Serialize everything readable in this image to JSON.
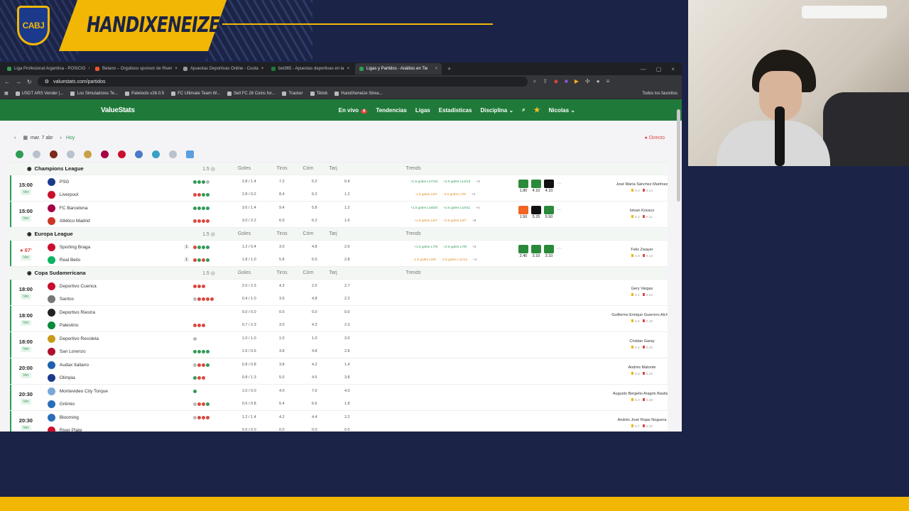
{
  "overlay": {
    "crest_text": "CABJ",
    "channel_name": "HANDIXENEIZE"
  },
  "browser": {
    "tabs": [
      {
        "title": "Liga Profesional Argentina - POSICIO",
        "color": "#2f9b56"
      },
      {
        "title": "Betano – Orgulloso sponsor de River",
        "color": "#e8572a"
      },
      {
        "title": "Apuestas Deportivas Online - Cuota",
        "color": "#999999"
      },
      {
        "title": "bet365 - Apuestas deportivas en la",
        "color": "#1f7a3a"
      },
      {
        "title": "Ligas y Partidos - Análisis en Tie",
        "color": "#2f9b56",
        "active": true
      }
    ],
    "url": "valuestats.com/partidos",
    "bookmarks": [
      "USDT ARS Vender |...",
      "Los Simuladores Te...",
      "Paletools v26.0.5",
      "FC Ultimate Team W...",
      "Sell FC 26 Coins for...",
      "Tracker",
      "Tiktok",
      "HandiXeneize Strea..."
    ],
    "bookmarks_right": "Todos los favoritos"
  },
  "site": {
    "logo": "ValueStats",
    "nav": {
      "live": "En vivo",
      "live_count": "6",
      "trends": "Tendencias",
      "leagues": "Ligas",
      "stats": "Estadísticas",
      "discipline": "Disciplina ⌄",
      "user": "Nicolas ⌄"
    },
    "date": "mar. 7 abr",
    "today": "Hoy",
    "live_label": "● Directo",
    "columns": {
      "line": "1.5 ◎",
      "goals": "Goles",
      "shots": "Tiros",
      "corners": "Córn",
      "cards": "Tarj",
      "trends": "Trends"
    },
    "ver_label": "Ver",
    "leagues": [
      {
        "name": "Champions League",
        "matches": [
          {
            "time": "15:00",
            "live": false,
            "home": {
              "name": "PSG",
              "color": "#1b3a8c",
              "form": [
                "g",
                "g",
                "g",
                "x"
              ],
              "goals": "2.8 / 1.4",
              "shots": "7.2",
              "corners": "5.2",
              "cards": "0.4"
            },
            "away": {
              "name": "Liverpool",
              "color": "#c8102e",
              "form": [
                "r",
                "r",
                "g",
                "g"
              ],
              "goals": "2.8 / 0.2",
              "shots": "8.4",
              "corners": "6.2",
              "cards": "1.2"
            },
            "trends_home": [
              "+1.5 goles L17/18",
              "+2.5 goles L12/13",
              "+6"
            ],
            "trends_away": [
              "-1.5 goles L6/7",
              "-2.5 goles L7/8",
              "+2"
            ],
            "odds": [
              {
                "v": "1.80",
                "c": "#2a8a3a"
              },
              {
                "v": "4.10",
                "c": "#2a8a3a"
              },
              {
                "v": "4.10",
                "c": "#111111"
              }
            ],
            "ref": {
              "name": "José María Sánchez Martínez",
              "y": "5.0",
              "r": "0.14"
            }
          },
          {
            "time": "15:00",
            "live": false,
            "home": {
              "name": "FC Barcelona",
              "color": "#a50044",
              "form": [
                "g",
                "g",
                "g",
                "g"
              ],
              "goals": "3.6 / 1.4",
              "shots": "9.4",
              "corners": "5.8",
              "cards": "1.2"
            },
            "away": {
              "name": "Atlético Madrid",
              "color": "#cb3524",
              "form": [
                "r",
                "r",
                "r",
                "r"
              ],
              "goals": "3.0 / 2.2",
              "shots": "6.0",
              "corners": "6.2",
              "cards": "1.6"
            },
            "trends_home": [
              "+1.5 goles L19/20",
              "+2.5 goles L10/11",
              "+4"
            ],
            "trends_away": [
              "+1.5 goles L6/7",
              "+2.5 goles L6/7",
              "+8"
            ],
            "odds": [
              {
                "v": "1.50",
                "c": "#f26522"
              },
              {
                "v": "5.25",
                "c": "#111111"
              },
              {
                "v": "5.50",
                "c": "#2a8a3a"
              }
            ],
            "ref": {
              "name": "Istvan Kovacs",
              "y": "5.2",
              "r": "0.11"
            }
          }
        ]
      },
      {
        "name": "Europa League",
        "matches": [
          {
            "time": "● 87'",
            "live": true,
            "home": {
              "name": "Sporting Braga",
              "color": "#c8102e",
              "rc": "1",
              "form": [
                "r",
                "g",
                "g",
                "g"
              ],
              "goals": "1.2 / 0.4",
              "shots": "3.0",
              "corners": "4.8",
              "cards": "2.6"
            },
            "away": {
              "name": "Real Betis",
              "color": "#0bb363",
              "rc": "1",
              "form": [
                "r",
                "g",
                "r",
                "g"
              ],
              "goals": "1.8 / 1.0",
              "shots": "5.8",
              "corners": "5.0",
              "cards": "2.8"
            },
            "trends_home": [
              "+1.5 goles L7/8",
              "+2.5 goles L7/8",
              "+6"
            ],
            "trends_away": [
              "-1.5 goles L8/9",
              "-2.5 goles L11/12",
              "+4"
            ],
            "odds": [
              {
                "v": "2.40",
                "c": "#2a8a3a"
              },
              {
                "v": "3.10",
                "c": "#2a8a3a"
              },
              {
                "v": "3.10",
                "c": "#2a8a3a"
              }
            ],
            "ref": {
              "name": "Felix Zwayer",
              "y": "4.8",
              "r": "0.13"
            }
          }
        ]
      },
      {
        "name": "Copa Sudamericana",
        "matches": [
          {
            "time": "18:00",
            "live": false,
            "home": {
              "name": "Deportivo Cuenca",
              "color": "#c8102e",
              "form": [
                "r",
                "r",
                "r"
              ],
              "goals": "2.0 / 2.3",
              "shots": "4.3",
              "corners": "2.0",
              "cards": "2.7"
            },
            "away": {
              "name": "Santos",
              "color": "#777777",
              "form": [
                "x",
                "r",
                "r",
                "r",
                "r"
              ],
              "goals": "0.4 / 1.0",
              "shots": "3.6",
              "corners": "4.8",
              "cards": "2.2"
            },
            "ref": {
              "name": "Gery Vargas",
              "y": "6.1",
              "r": "0.22"
            }
          },
          {
            "time": "18:00",
            "live": false,
            "home": {
              "name": "Deportivo Riestra",
              "color": "#222222",
              "form": [],
              "goals": "0.0 / 0.0",
              "shots": "0.0",
              "corners": "0.0",
              "cards": "0.0"
            },
            "away": {
              "name": "Palestino",
              "color": "#0a8a3a",
              "form": [
                "r",
                "r",
                "r"
              ],
              "goals": "0.7 / 2.3",
              "shots": "3.0",
              "corners": "4.3",
              "cards": "2.3"
            },
            "ref": {
              "name": "Guillermo Enrique Guerrero Alcívar",
              "y": "4.5",
              "r": "0.19"
            }
          },
          {
            "time": "18:00",
            "live": false,
            "home": {
              "name": "Deportivo Recoleta",
              "color": "#c89b17",
              "form": [
                "x"
              ],
              "goals": "1.0 / 1.0",
              "shots": "1.0",
              "corners": "1.0",
              "cards": "3.0"
            },
            "away": {
              "name": "San Lorenzo",
              "color": "#b0102e",
              "form": [
                "g",
                "g",
                "g",
                "g"
              ],
              "goals": "1.6 / 0.6",
              "shots": "3.8",
              "corners": "4.8",
              "cards": "2.8"
            },
            "ref": {
              "name": "Cristian Garay",
              "y": "4.4",
              "r": "0.25"
            }
          },
          {
            "time": "20:00",
            "live": false,
            "home": {
              "name": "Audax Italiano",
              "color": "#1e5fb0",
              "form": [
                "x",
                "r",
                "r",
                "g"
              ],
              "goals": "0.8 / 0.8",
              "shots": "3.8",
              "corners": "4.2",
              "cards": "1.4"
            },
            "away": {
              "name": "Olimpia",
              "color": "#1b3a8c",
              "form": [
                "g",
                "r",
                "r"
              ],
              "goals": "0.8 / 1.3",
              "shots": "5.0",
              "corners": "4.5",
              "cards": "3.8"
            },
            "ref": {
              "name": "Andrés Matonte",
              "y": "5.8",
              "r": "0.22"
            }
          },
          {
            "time": "20:30",
            "live": false,
            "home": {
              "name": "Montevideo City Torque",
              "color": "#7aa7d8",
              "form": [
                "g"
              ],
              "goals": "1.0 / 0.0",
              "shots": "4.0",
              "corners": "7.0",
              "cards": "4.0"
            },
            "away": {
              "name": "Grêmio",
              "color": "#2a6ebb",
              "form": [
                "x",
                "r",
                "r",
                "g"
              ],
              "goals": "0.6 / 0.8",
              "shots": "5.4",
              "corners": "6.6",
              "cards": "1.8"
            },
            "ref": {
              "name": "Augusto Bergelio Aragón Bautista",
              "y": "5.2",
              "r": "0.28"
            }
          },
          {
            "time": "20:30",
            "live": false,
            "home": {
              "name": "Blooming",
              "color": "#2a6ebb",
              "form": [
                "x",
                "r",
                "r",
                "r"
              ],
              "goals": "1.2 / 1.4",
              "shots": "4.2",
              "corners": "4.4",
              "cards": "2.2"
            },
            "away": {
              "name": "River Plate",
              "color": "#c8102e",
              "form": [],
              "goals": "0.0 / 0.0",
              "shots": "0.0",
              "corners": "0.0",
              "cards": "0.0"
            },
            "ref": {
              "name": "Andrés José Rojas Noguera",
              "y": "5.7",
              "r": "0.32"
            }
          }
        ]
      }
    ]
  },
  "colors": {
    "brand": "#1f7a3a",
    "accent": "#f2b705",
    "green": "#2f9b56",
    "red": "#d9483f",
    "grey": "#b9b9b9"
  }
}
